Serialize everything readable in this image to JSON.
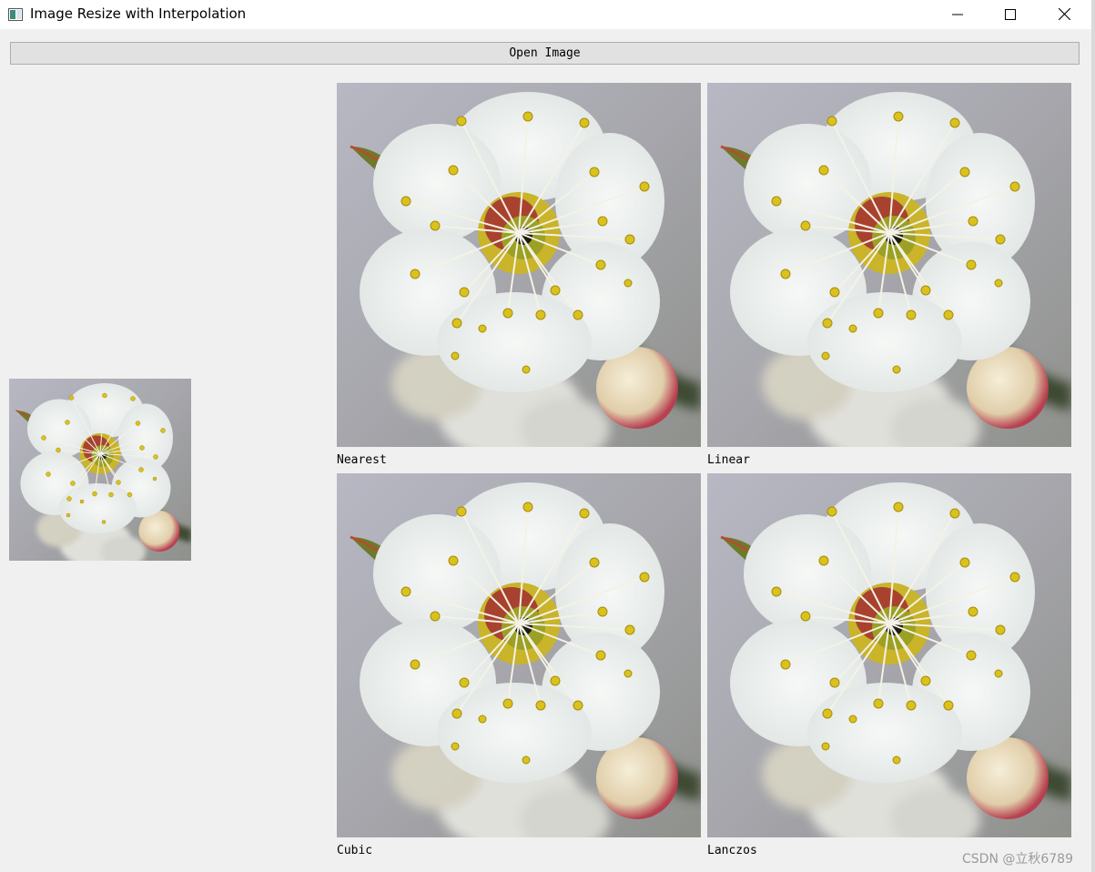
{
  "window": {
    "title": "Image Resize with Interpolation",
    "controls": {
      "minimize_icon": "minimize-icon",
      "maximize_icon": "maximize-icon",
      "close_icon": "close-icon"
    }
  },
  "toolbar": {
    "open_label": "Open Image"
  },
  "images": {
    "original": {
      "icon": "flower-image"
    },
    "results": [
      {
        "label": "Nearest",
        "icon": "flower-image"
      },
      {
        "label": "Linear",
        "icon": "flower-image"
      },
      {
        "label": "Cubic",
        "icon": "flower-image"
      },
      {
        "label": "Lanczos",
        "icon": "flower-image"
      }
    ]
  },
  "watermark": "CSDN @立秋6789",
  "colors": {
    "background": "#f0f0f0",
    "button_face": "#e1e1e1",
    "flower_petal": "#eef2f0",
    "stamen": "#d8c21a",
    "bud": "#e8d9b8"
  }
}
